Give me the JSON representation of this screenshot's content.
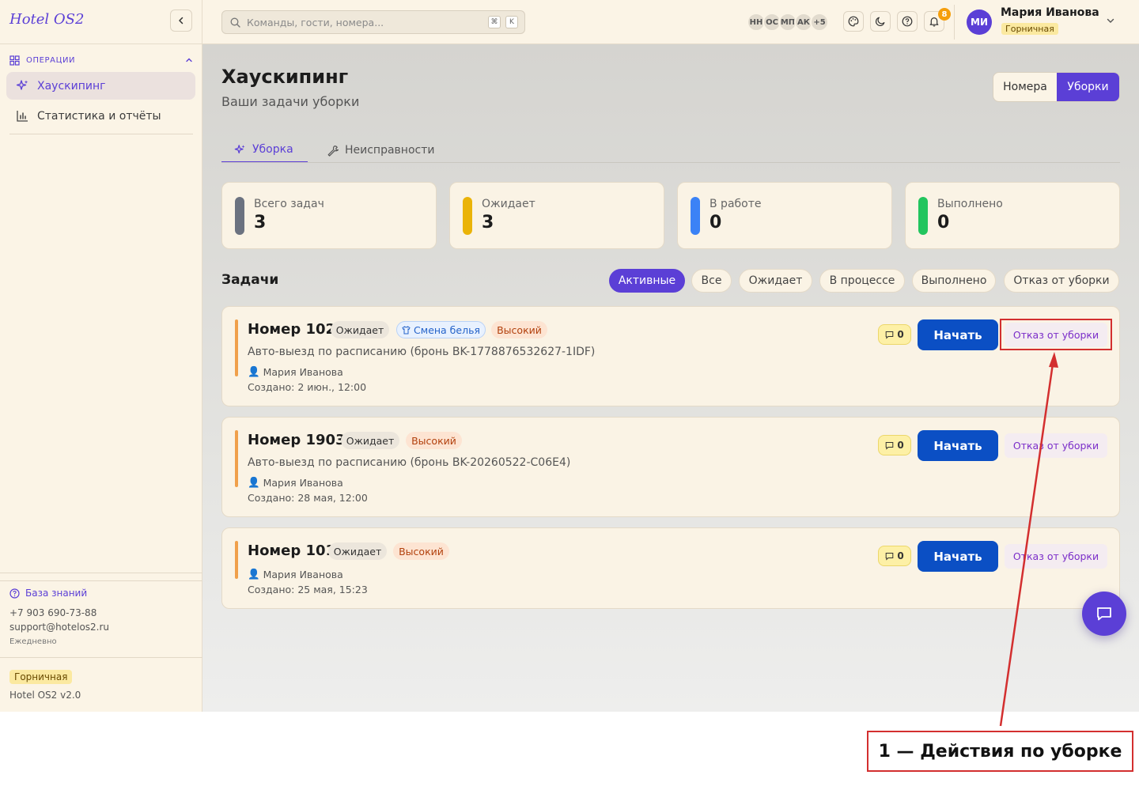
{
  "sidebar": {
    "logo": "Hotel OS2",
    "section_label": "ОПЕРАЦИИ",
    "items": [
      {
        "label": "Хаускипинг"
      },
      {
        "label": "Статистика и отчёты"
      }
    ],
    "kb_label": "База знаний",
    "phone": "+7 903 690-73-88",
    "email": "support@hotelos2.ru",
    "schedule": "Ежедневно",
    "role": "Горничная",
    "version": "Hotel OS2 v2.0"
  },
  "topbar": {
    "search_placeholder": "Команды, гости, номера...",
    "kbd_1": "⌘",
    "kbd_2": "K",
    "avatars": [
      "НН",
      "ОС",
      "МП",
      "АК",
      "+5"
    ],
    "notif_count": "8",
    "user_initials": "МИ",
    "user_name": "Мария Иванова",
    "user_role": "Горничная"
  },
  "main": {
    "title": "Хаускипинг",
    "subtitle": "Ваши задачи уборки",
    "view_toggle": [
      "Номера",
      "Уборки"
    ],
    "tabs": [
      {
        "label": "Уборка"
      },
      {
        "label": "Неисправности"
      }
    ],
    "stats": [
      {
        "label": "Всего задач",
        "value": "3",
        "color": "#6b7280"
      },
      {
        "label": "Ожидает",
        "value": "3",
        "color": "#eab308"
      },
      {
        "label": "В работе",
        "value": "0",
        "color": "#3b82f6"
      },
      {
        "label": "Выполнено",
        "value": "0",
        "color": "#22c55e"
      }
    ],
    "tasks_title": "Задачи",
    "filters": [
      "Активные",
      "Все",
      "Ожидает",
      "В процессе",
      "Выполнено",
      "Отказ от уборки"
    ],
    "tasks": [
      {
        "room": "Номер 102",
        "status": "Ожидает",
        "type": "Смена белья",
        "priority": "Высокий",
        "description": "Авто-выезд по расписанию (бронь BK-1778876532627-1IDF)",
        "assignee": "Мария Иванова",
        "created": "Создано: 2 июн., 12:00",
        "comments": "0",
        "start_label": "Начать",
        "refuse_label": "Отказ от уборки"
      },
      {
        "room": "Номер 1903",
        "status": "Ожидает",
        "priority": "Высокий",
        "description": "Авто-выезд по расписанию (бронь BK-20260522-C06E4)",
        "assignee": "Мария Иванова",
        "created": "Создано: 28 мая, 12:00",
        "comments": "0",
        "start_label": "Начать",
        "refuse_label": "Отказ от уборки"
      },
      {
        "room": "Номер 101",
        "status": "Ожидает",
        "priority": "Высокий",
        "assignee": "Мария Иванова",
        "created": "Создано: 25 мая, 15:23",
        "comments": "0",
        "start_label": "Начать",
        "refuse_label": "Отказ от уборки"
      }
    ]
  },
  "annotation": {
    "label": "1 — Действия по уборке"
  },
  "colors": {
    "accent": "#5b3fd6",
    "primary_button": "#0b4fc4",
    "annotation": "#d32f2f"
  },
  "icons": [
    "chevron-left-icon",
    "grid-icon",
    "sparkle-icon",
    "bar-chart-icon",
    "help-circle-icon",
    "search-icon",
    "palette-icon",
    "moon-icon",
    "bell-icon",
    "chevron-down-icon",
    "wrench-icon",
    "shirt-icon",
    "comment-icon",
    "user-icon",
    "chat-icon"
  ]
}
